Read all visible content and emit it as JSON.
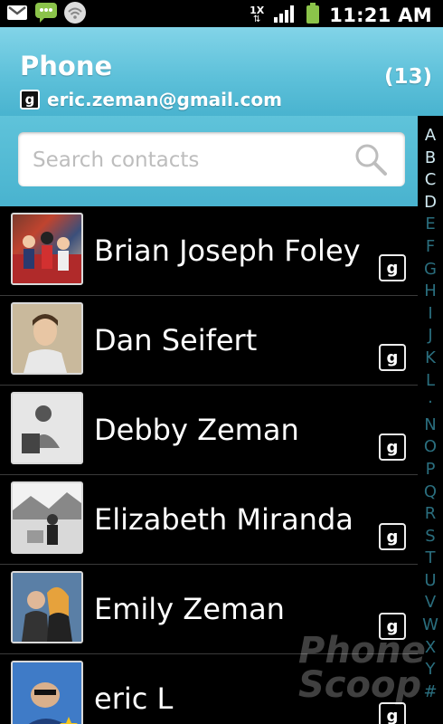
{
  "status_bar": {
    "time": "11:21 AM",
    "icons": [
      "gmail-icon",
      "messaging-icon",
      "wifi-icon",
      "1x-data-icon",
      "signal-icon",
      "battery-icon"
    ],
    "data_label": "1X"
  },
  "header": {
    "title": "Phone",
    "account": "eric.zeman@gmail.com",
    "count": "(13)"
  },
  "search": {
    "placeholder": "Search contacts"
  },
  "alphabet": [
    "A",
    "B",
    "C",
    "D",
    "E",
    "F",
    "G",
    "H",
    "I",
    "J",
    "K",
    "L",
    "·",
    "N",
    "O",
    "P",
    "Q",
    "R",
    "S",
    "T",
    "U",
    "V",
    "W",
    "X",
    "Y",
    "#"
  ],
  "contacts": [
    {
      "name": "Brian Joseph Foley",
      "account_badge": "g"
    },
    {
      "name": "Dan Seifert",
      "account_badge": "g"
    },
    {
      "name": "Debby Zeman",
      "account_badge": "g"
    },
    {
      "name": "Elizabeth Miranda",
      "account_badge": "g"
    },
    {
      "name": "Emily Zeman",
      "account_badge": "g"
    },
    {
      "name": "eric L",
      "account_badge": "g"
    }
  ],
  "watermark": "Phone Scoop",
  "colors": {
    "header": "#5ec1da",
    "background": "#000000",
    "text": "#ffffff"
  }
}
